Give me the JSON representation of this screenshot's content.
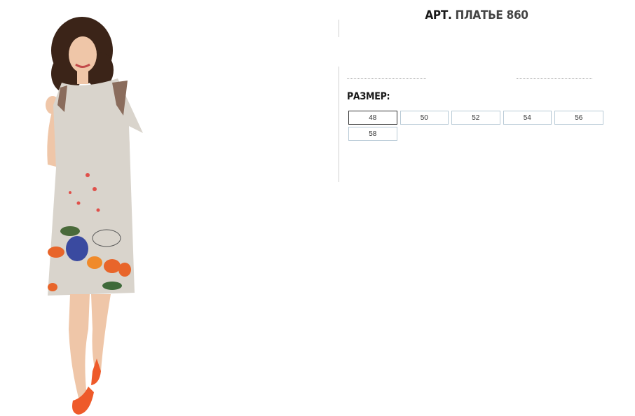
{
  "product": {
    "title_prefix": "АРТ.",
    "title_name": "ПЛАТЬЕ 860",
    "image_alt": "model-in-linen-dress-with-floral-print"
  },
  "size_selector": {
    "label": "РАЗМЕР:",
    "selected": "48",
    "options": [
      "48",
      "50",
      "52",
      "54",
      "56",
      "58"
    ]
  },
  "colors": {
    "dress": "#d9d4cc",
    "shoes": "#ee5a2a",
    "border_selected": "#333333",
    "border_default": "#b8cad6"
  }
}
